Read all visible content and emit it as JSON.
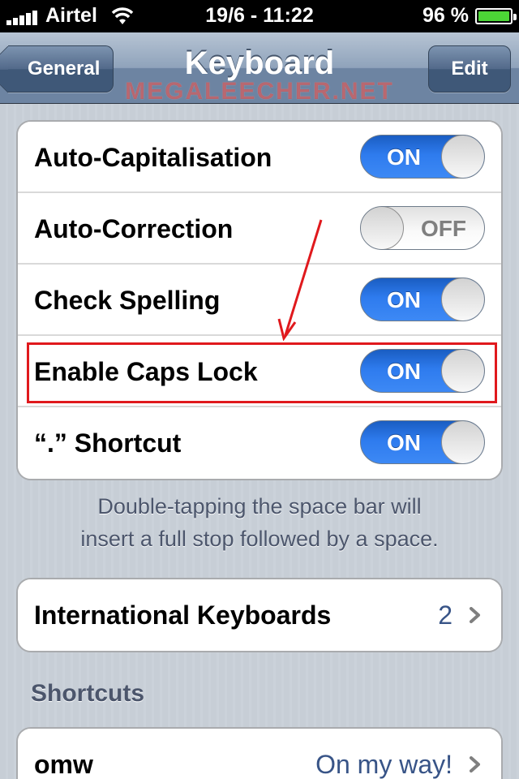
{
  "status_bar": {
    "carrier": "Airtel",
    "time": "19/6 - 11:22",
    "battery": "96 %",
    "icons": [
      "signal-bars-icon",
      "wifi-icon",
      "battery-icon"
    ]
  },
  "nav": {
    "title": "Keyboard",
    "back_label": "General",
    "edit_label": "Edit",
    "watermark": "MEGALEECHER.NET"
  },
  "settings": [
    {
      "label": "Auto-Capitalisation",
      "state": "ON"
    },
    {
      "label": "Auto-Correction",
      "state": "OFF"
    },
    {
      "label": "Check Spelling",
      "state": "ON"
    },
    {
      "label": "Enable Caps Lock",
      "state": "ON"
    },
    {
      "label": "“.” Shortcut",
      "state": "ON"
    }
  ],
  "footnote": {
    "line1": "Double-tapping the space bar will",
    "line2": "insert a full stop followed by a space."
  },
  "international": {
    "label": "International Keyboards",
    "value": "2"
  },
  "shortcuts": {
    "header": "Shortcuts",
    "items": [
      {
        "label": "omw",
        "value": "On my way!"
      }
    ]
  },
  "colors": {
    "switch_on": "#2e7bee",
    "detail_text": "#385487",
    "annotation": "#e0191d"
  }
}
